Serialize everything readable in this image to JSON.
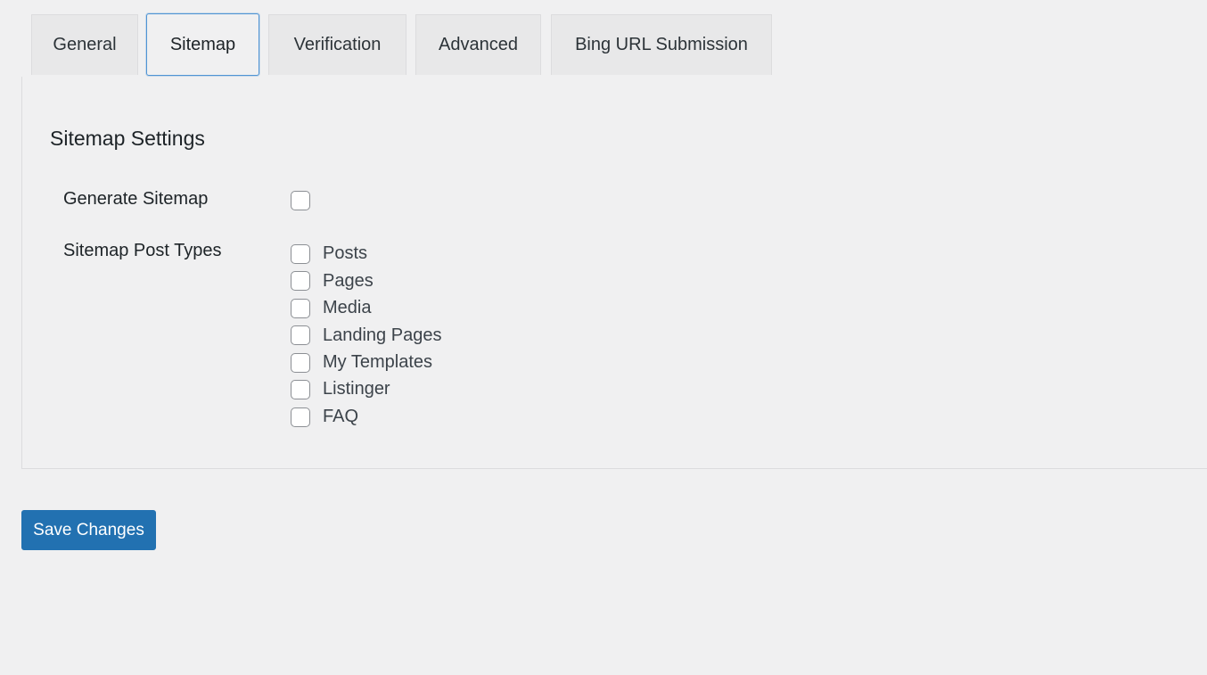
{
  "tabs": [
    {
      "label": "General",
      "active": false
    },
    {
      "label": "Sitemap",
      "active": true
    },
    {
      "label": "Verification",
      "active": false
    },
    {
      "label": "Advanced",
      "active": false
    },
    {
      "label": "Bing URL Submission",
      "active": false
    }
  ],
  "section": {
    "title": "Sitemap Settings",
    "generate_sitemap": {
      "label": "Generate Sitemap",
      "checked": false
    },
    "post_types": {
      "label": "Sitemap Post Types",
      "options": [
        {
          "label": "Posts",
          "checked": false
        },
        {
          "label": "Pages",
          "checked": false
        },
        {
          "label": "Media",
          "checked": false
        },
        {
          "label": "Landing Pages",
          "checked": false
        },
        {
          "label": "My Templates",
          "checked": false
        },
        {
          "label": "Listinger",
          "checked": false
        },
        {
          "label": "FAQ",
          "checked": false
        }
      ]
    }
  },
  "actions": {
    "save_label": "Save Changes"
  },
  "colors": {
    "accent": "#2271b1",
    "active_tab_border": "#4f94d4",
    "background": "#f0f0f1"
  }
}
